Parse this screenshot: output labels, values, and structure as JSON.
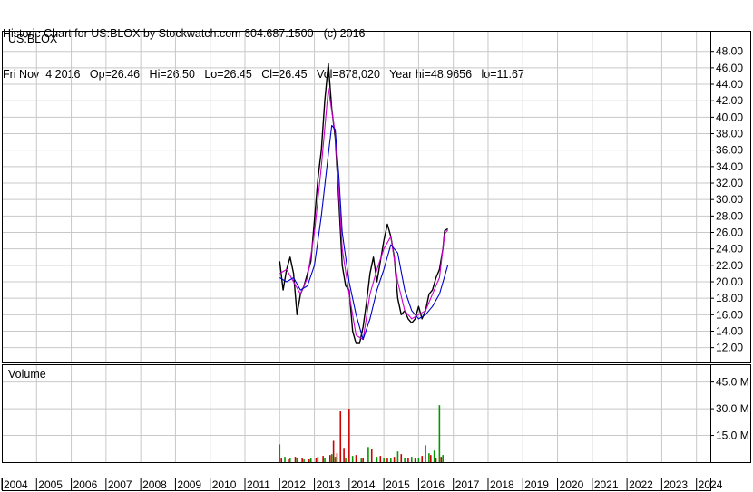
{
  "header": {
    "line1": "Historic Chart for US:BLOX by Stockwatch.com 604.687.1500 - (c) 2016",
    "line2": "Fri Nov  4 2016   Op=26.46   Hi=26.50   Lo=26.45   Cl=26.45   Vol=878,020   Year hi=48.9656   lo=11.67"
  },
  "colors": {
    "price": "#000000",
    "ma_short": "#cc00cc",
    "ma_long": "#0000cc",
    "vol_up": "#009900",
    "vol_down": "#cc0000",
    "grid": "#c8c8c8"
  },
  "chart_data": [
    {
      "type": "line",
      "ticker_label": "US:BLOX",
      "y_tick_labels": [
        "12.00",
        "14.00",
        "16.00",
        "18.00",
        "20.00",
        "22.00",
        "24.00",
        "26.00",
        "28.00",
        "30.00",
        "32.00",
        "34.00",
        "36.00",
        "38.00",
        "40.00",
        "42.00",
        "44.00",
        "46.00",
        "48.00"
      ],
      "y_ticks": [
        12,
        14,
        16,
        18,
        20,
        22,
        24,
        26,
        28,
        30,
        32,
        34,
        36,
        38,
        40,
        42,
        44,
        46,
        48
      ],
      "ylim": [
        10.2,
        50.5
      ],
      "x_labels": [
        "2004",
        "2005",
        "2006",
        "2007",
        "2008",
        "2009",
        "2010",
        "2011",
        "2012",
        "2013",
        "2014",
        "2015",
        "2016",
        "2017",
        "2018",
        "2019",
        "2020",
        "2021",
        "2022",
        "2023",
        "2024"
      ],
      "xlim": [
        2004.0,
        2024.4
      ],
      "grid": true,
      "series": [
        {
          "key": "price",
          "x": [
            2012.0,
            2012.1,
            2012.2,
            2012.3,
            2012.4,
            2012.5,
            2012.6,
            2012.7,
            2012.8,
            2012.9,
            2013.0,
            2013.1,
            2013.2,
            2013.3,
            2013.4,
            2013.5,
            2013.6,
            2013.7,
            2013.8,
            2013.9,
            2014.0,
            2014.1,
            2014.2,
            2014.3,
            2014.4,
            2014.5,
            2014.6,
            2014.7,
            2014.8,
            2014.9,
            2015.0,
            2015.1,
            2015.2,
            2015.3,
            2015.4,
            2015.5,
            2015.6,
            2015.7,
            2015.8,
            2015.9,
            2016.0,
            2016.1,
            2016.2,
            2016.3,
            2016.4,
            2016.5,
            2016.6,
            2016.7,
            2016.75,
            2016.84
          ],
          "values": [
            22.5,
            19.0,
            21.5,
            23.0,
            21.0,
            16.0,
            18.5,
            19.5,
            21.0,
            22.5,
            27.5,
            32.5,
            36.0,
            42.0,
            46.5,
            41.0,
            37.5,
            30.0,
            22.0,
            19.5,
            19.0,
            14.0,
            12.5,
            12.5,
            14.5,
            17.5,
            21.0,
            23.0,
            20.0,
            22.5,
            25.0,
            27.0,
            25.5,
            23.0,
            18.0,
            16.0,
            16.5,
            15.5,
            15.0,
            15.5,
            17.0,
            15.5,
            16.5,
            18.5,
            19.0,
            20.5,
            21.5,
            24.0,
            26.2,
            26.45
          ]
        },
        {
          "key": "ma_short",
          "x": [
            2012.0,
            2012.2,
            2012.4,
            2012.6,
            2012.8,
            2013.0,
            2013.2,
            2013.4,
            2013.6,
            2013.8,
            2014.0,
            2014.2,
            2014.4,
            2014.6,
            2014.8,
            2015.0,
            2015.2,
            2015.4,
            2015.6,
            2015.8,
            2016.0,
            2016.2,
            2016.4,
            2016.6,
            2016.75,
            2016.84
          ],
          "values": [
            21.0,
            21.5,
            20.0,
            18.5,
            20.5,
            26.0,
            34.0,
            43.5,
            38.0,
            24.0,
            18.5,
            13.5,
            13.0,
            18.5,
            21.5,
            24.0,
            25.5,
            20.0,
            16.5,
            15.5,
            16.0,
            16.5,
            18.5,
            20.5,
            25.8,
            26.3
          ]
        },
        {
          "key": "ma_long",
          "x": [
            2012.0,
            2012.2,
            2012.4,
            2012.6,
            2012.8,
            2013.0,
            2013.2,
            2013.4,
            2013.5,
            2013.6,
            2013.7,
            2013.8,
            2014.0,
            2014.2,
            2014.4,
            2014.6,
            2014.8,
            2015.0,
            2015.2,
            2015.4,
            2015.6,
            2015.8,
            2016.0,
            2016.2,
            2016.4,
            2016.6,
            2016.84
          ],
          "values": [
            20.5,
            20.0,
            20.5,
            19.0,
            19.5,
            22.0,
            28.0,
            35.5,
            39.0,
            38.5,
            33.0,
            26.0,
            20.0,
            16.0,
            13.0,
            15.5,
            19.0,
            21.5,
            24.5,
            23.5,
            19.0,
            16.5,
            15.5,
            16.0,
            17.0,
            18.5,
            22.0
          ]
        }
      ]
    },
    {
      "type": "bar",
      "title": "Volume",
      "y_tick_labels": [
        "15.0 M",
        "30.0 M",
        "45.0 M"
      ],
      "y_ticks": [
        15,
        30,
        45
      ],
      "ylim": [
        0,
        55
      ],
      "unit": "M",
      "series": [
        {
          "key": "vol_up",
          "x": [
            2012.0,
            2012.15,
            2012.3,
            2012.5,
            2012.7,
            2012.9,
            2013.1,
            2013.3,
            2013.5,
            2013.6,
            2013.9,
            2014.1,
            2014.35,
            2014.55,
            2014.8,
            2015.0,
            2015.2,
            2015.4,
            2015.6,
            2015.8,
            2016.0,
            2016.2,
            2016.3,
            2016.45,
            2016.6,
            2016.7
          ],
          "values": [
            10.0,
            3.0,
            2.0,
            2.5,
            1.5,
            2.0,
            3.0,
            2.5,
            4.5,
            3.0,
            2.5,
            3.5,
            2.0,
            8.5,
            3.0,
            2.5,
            2.0,
            6.0,
            2.5,
            3.0,
            2.5,
            9.5,
            5.0,
            6.5,
            32.0,
            4.0
          ]
        },
        {
          "key": "vol_down",
          "x": [
            2012.05,
            2012.25,
            2012.45,
            2012.65,
            2012.85,
            2013.05,
            2013.25,
            2013.45,
            2013.55,
            2013.65,
            2013.75,
            2013.85,
            2014.0,
            2014.2,
            2014.4,
            2014.65,
            2014.9,
            2015.1,
            2015.3,
            2015.5,
            2015.7,
            2015.9,
            2016.1,
            2016.35,
            2016.5,
            2016.65
          ],
          "values": [
            2.0,
            1.5,
            3.0,
            2.0,
            1.5,
            2.5,
            3.5,
            4.0,
            12.0,
            5.0,
            28.5,
            8.0,
            30.0,
            4.0,
            2.5,
            7.5,
            3.5,
            2.0,
            3.0,
            4.5,
            2.5,
            2.0,
            3.5,
            4.0,
            2.5,
            3.0
          ]
        }
      ]
    }
  ]
}
